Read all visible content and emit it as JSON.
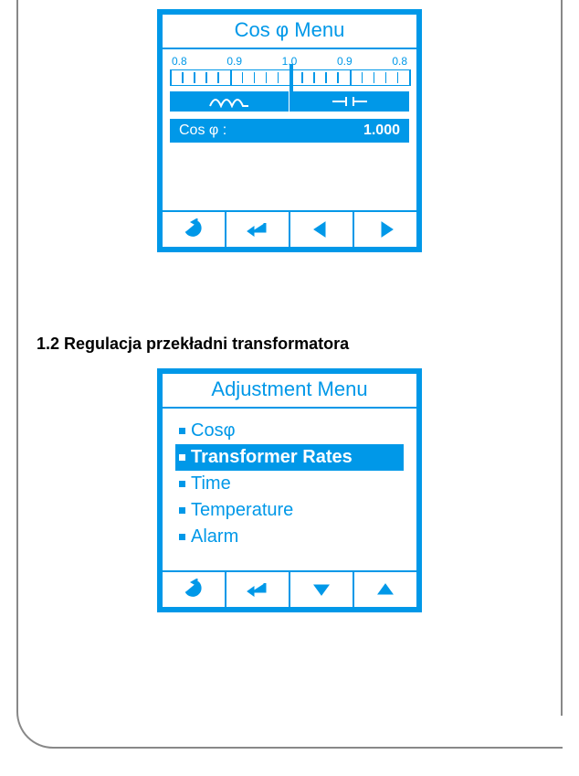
{
  "colors": {
    "accent": "#0098e8"
  },
  "screen_cos": {
    "title": "Cos φ Menu",
    "scale_labels": [
      "0.8",
      "0.9",
      "1.0",
      "0.9",
      "0.8"
    ],
    "inductive_icon": "inductive-icon",
    "capacitive_icon": "capacitive-icon",
    "readout_label": "Cos φ  :",
    "readout_value": "1.000",
    "buttons": {
      "back": "back-icon",
      "enter": "enter-icon",
      "left": "left-icon",
      "right": "right-icon"
    }
  },
  "section_heading": "1.2 Regulacja przekładni transformatora",
  "screen_adjust": {
    "title": "Adjustment Menu",
    "items": [
      {
        "label": "Cosφ",
        "selected": false
      },
      {
        "label": "Transformer Rates",
        "selected": true
      },
      {
        "label": "Time",
        "selected": false
      },
      {
        "label": "Temperature",
        "selected": false
      },
      {
        "label": "Alarm",
        "selected": false
      }
    ],
    "buttons": {
      "back": "back-icon",
      "enter": "enter-icon",
      "down": "down-icon",
      "up": "up-icon"
    }
  }
}
